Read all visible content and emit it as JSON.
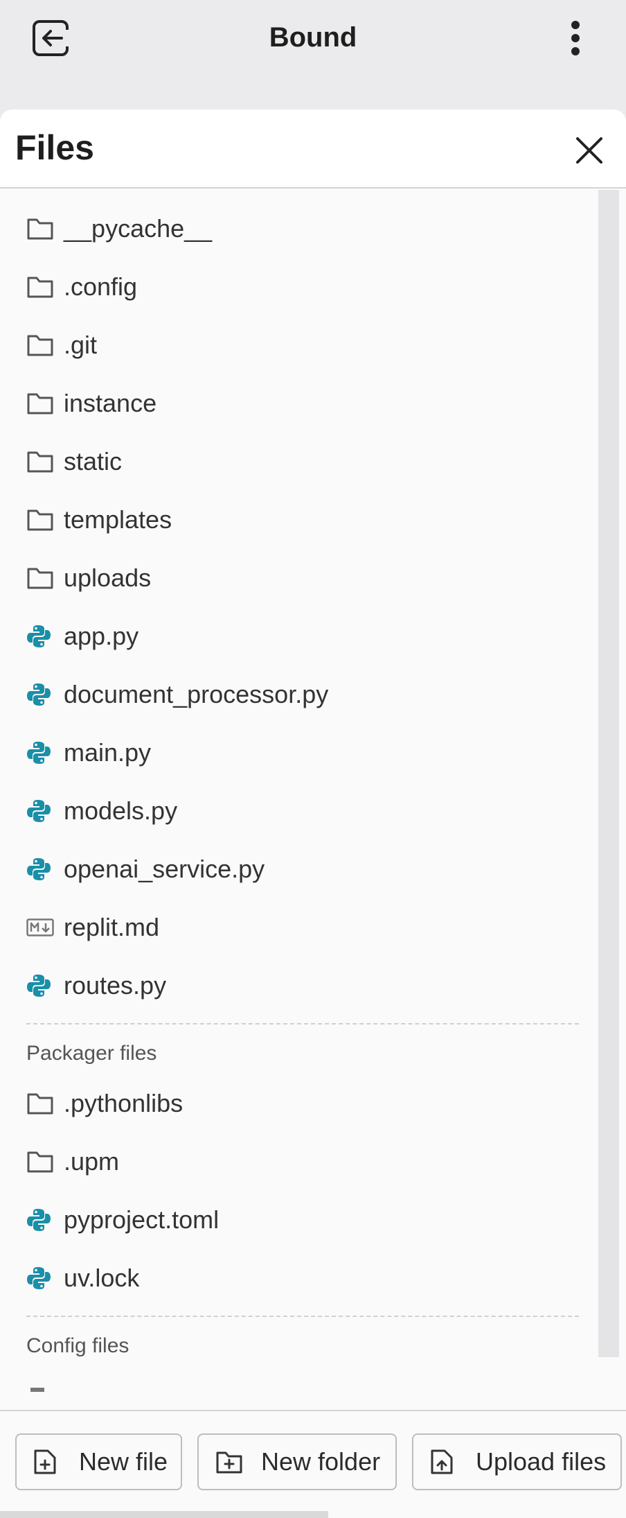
{
  "app": {
    "title": "Bound"
  },
  "panel": {
    "title": "Files"
  },
  "files": [
    {
      "name": "__pycache__",
      "icon": "folder-icon"
    },
    {
      "name": ".config",
      "icon": "folder-icon"
    },
    {
      "name": ".git",
      "icon": "folder-icon"
    },
    {
      "name": "instance",
      "icon": "folder-icon"
    },
    {
      "name": "static",
      "icon": "folder-icon"
    },
    {
      "name": "templates",
      "icon": "folder-icon"
    },
    {
      "name": "uploads",
      "icon": "folder-icon"
    },
    {
      "name": "app.py",
      "icon": "python-icon"
    },
    {
      "name": "document_processor.py",
      "icon": "python-icon"
    },
    {
      "name": "main.py",
      "icon": "python-icon"
    },
    {
      "name": "models.py",
      "icon": "python-icon"
    },
    {
      "name": "openai_service.py",
      "icon": "python-icon"
    },
    {
      "name": "replit.md",
      "icon": "markdown-icon"
    },
    {
      "name": "routes.py",
      "icon": "python-icon"
    }
  ],
  "packager": {
    "title": "Packager files",
    "items": [
      {
        "name": ".pythonlibs",
        "icon": "folder-icon"
      },
      {
        "name": ".upm",
        "icon": "folder-icon"
      },
      {
        "name": "pyproject.toml",
        "icon": "python-icon"
      },
      {
        "name": "uv.lock",
        "icon": "python-icon"
      }
    ]
  },
  "config": {
    "title": "Config files"
  },
  "footer": {
    "new_file": "New file",
    "new_folder": "New folder",
    "upload_files": "Upload files"
  },
  "colors": {
    "python": "#1a8fa8",
    "icon_gray": "#555555",
    "background": "#ebebed",
    "panel": "#fafafa"
  }
}
